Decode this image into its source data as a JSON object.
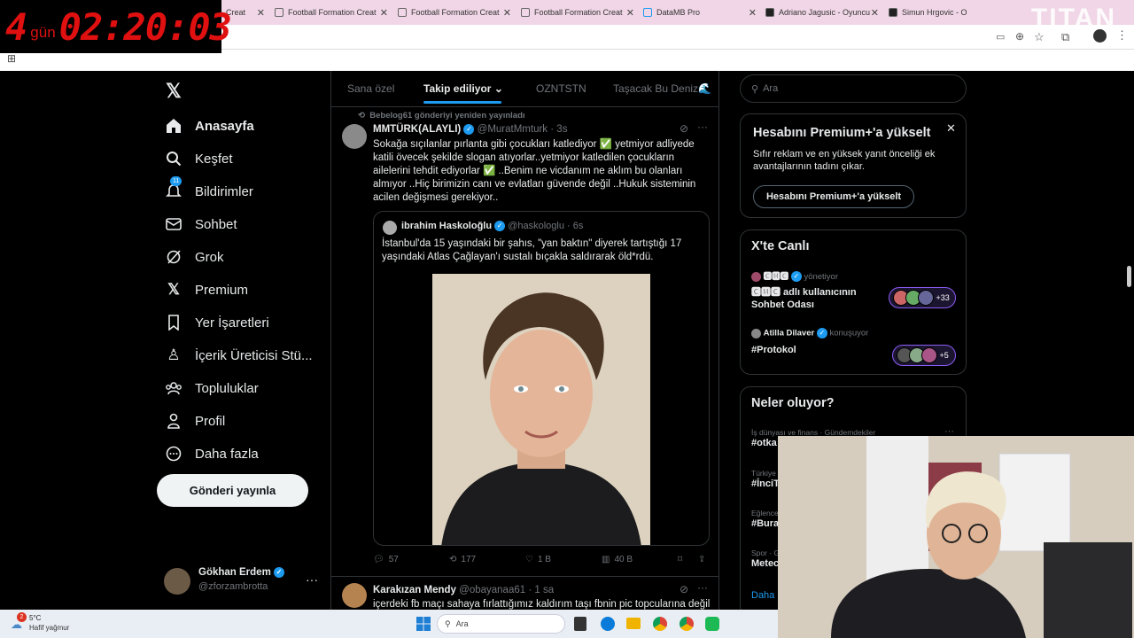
{
  "timer": {
    "days": "4",
    "days_label": "gün",
    "time": "02:20:03"
  },
  "brand": {
    "text": "TITAN"
  },
  "browser": {
    "tabs": [
      {
        "label": "Football Formation Creat"
      },
      {
        "label": "Football Formation Creat"
      },
      {
        "label": "Football Formation Creat"
      },
      {
        "label": "Football Formation Creat"
      },
      {
        "label": "DataMB Pro"
      },
      {
        "label": "Adriano Jagusic - Oyuncu"
      },
      {
        "label": "Simun Hrgovic - O"
      }
    ]
  },
  "sidebar": {
    "items": [
      {
        "label": "Anasayfa",
        "icon": "home-icon"
      },
      {
        "label": "Keşfet",
        "icon": "search-icon"
      },
      {
        "label": "Bildirimler",
        "icon": "bell-icon",
        "badge": "11"
      },
      {
        "label": "Sohbet",
        "icon": "mail-icon"
      },
      {
        "label": "Grok",
        "icon": "grok-icon"
      },
      {
        "label": "Premium",
        "icon": "x-logo-icon"
      },
      {
        "label": "Yer İşaretleri",
        "icon": "bookmark-icon"
      },
      {
        "label": "İçerik Üreticisi Stü...",
        "icon": "creator-studio-icon"
      },
      {
        "label": "Topluluklar",
        "icon": "communities-icon"
      },
      {
        "label": "Profil",
        "icon": "person-icon"
      },
      {
        "label": "Daha fazla",
        "icon": "more-circle-icon"
      }
    ],
    "post_button": "Gönderi yayınla",
    "account": {
      "name": "Gökhan Erdem",
      "handle": "@zforzambrotta"
    }
  },
  "feed": {
    "tabs": [
      "Sana özel",
      "Takip ediliyor",
      "OZNTSTN",
      "Taşacak Bu Deniz🌊"
    ],
    "tweet": {
      "repost_notice": "Bebelog61 gönderiyi yeniden yayınladı",
      "author": "MMTÜRK(ALAYLI)",
      "handle": "@MuratMmturk",
      "time": "3s",
      "text": "Sokağa sıçılanlar pırlanta gibi çocukları katlediyor ✅ yetmiyor adliyede katili övecek şekilde  slogan atıyorlar..yetmiyor katledilen çocukların ailelerini tehdit ediyorlar ✅ ..Benim ne vicdanım ne aklım bu olanları almıyor ..Hiç birimizin canı ve evlatları güvende değil ..Hukuk sisteminin acilen değişmesi gerekiyor..",
      "quote": {
        "author": "ibrahim Haskoloğlu",
        "handle": "@haskologlu",
        "time": "6s",
        "text": "İstanbul'da 15 yaşındaki bir şahıs, \"yan baktın\" diyerek tartıştığı 17 yaşındaki Atlas Çağlayan'ı sustalı bıçakla saldırarak öld*rdü."
      },
      "stats": {
        "replies": "57",
        "reposts": "177",
        "likes": "1 B",
        "views": "40 B"
      }
    },
    "next_tweet": {
      "author": "Karakızan Mendy",
      "handle": "@obayanaa61",
      "time": "1 sa",
      "text": "içerdeki fb maçı sahaya fırlattığımız kaldırım taşı fbnin pic topcularına değil"
    }
  },
  "right": {
    "search_placeholder": "Ara",
    "premium": {
      "title": "Hesabını Premium+'a yükselt",
      "body": "Sıfır reklam ve en yüksek yanıt önceliği ek avantajlarının tadını çıkar.",
      "button": "Hesabını Premium+'a yükselt"
    },
    "live": {
      "title": "X'te Canlı",
      "spaces": [
        {
          "host": "🅲🅼🅲",
          "role": "yönetiyor",
          "title": "🅲🅼🅲 adlı kullanıcının Sohbet Odası",
          "count": "+33"
        },
        {
          "host": "Atilla Dilaver",
          "role": "konuşuyor",
          "title": "#Protokol",
          "count": "+5"
        }
      ]
    },
    "trends": {
      "title": "Neler oluyor?",
      "items": [
        {
          "context": "İş dünyası ve finans · Gündemdekiler",
          "tag": "#otka"
        },
        {
          "context": "Türkiye",
          "tag": "#İnciT"
        },
        {
          "context": "Eğlence",
          "tag": "#Bura"
        },
        {
          "context": "Spor · G",
          "tag": "Metec"
        }
      ],
      "more": "Daha"
    }
  },
  "taskbar": {
    "weather_temp": "5°C",
    "weather_desc": "Hafif yağmur",
    "search": "Ara",
    "weather_badge": "2"
  }
}
